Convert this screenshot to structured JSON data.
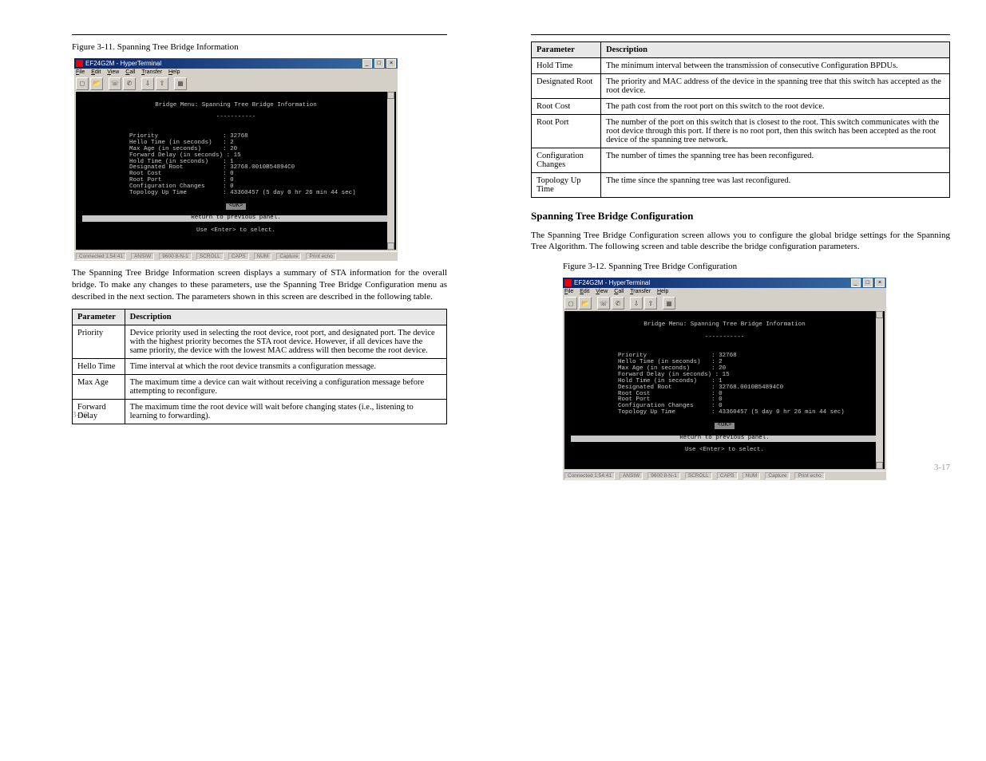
{
  "left": {
    "header": {
      "left": "",
      "right": ""
    },
    "figure_label": "Figure 3-11. Spanning Tree Bridge Information",
    "term": {
      "title": "EF24G2M - HyperTerminal",
      "menus": [
        "File",
        "Edit",
        "View",
        "Call",
        "Transfer",
        "Help"
      ],
      "screen_title": "Bridge Menu: Spanning Tree Bridge Information",
      "dashes": "-----------",
      "rows": [
        {
          "label": "Priority",
          "value": "32768"
        },
        {
          "label": "Hello Time (in seconds)",
          "value": "2"
        },
        {
          "label": "Max Age (in seconds)",
          "value": "20"
        },
        {
          "label": "Forward Delay (in seconds)",
          "value": "15"
        },
        {
          "label": "Hold Time (in seconds)",
          "value": "1"
        },
        {
          "label": "Designated Root",
          "value": "32768.0010B54894C0"
        },
        {
          "label": "Root Cost",
          "value": "0"
        },
        {
          "label": "Root Port",
          "value": "0"
        },
        {
          "label": "Configuration Changes",
          "value": "0"
        },
        {
          "label": "Topology Up Time",
          "value": "43360457 (5 day 0 hr 26 min 44 sec)"
        }
      ],
      "ok": "<OK>",
      "return_line": "Return to previous panel.",
      "enter_line": "Use <Enter> to select.",
      "status": [
        "Connected 1:54:41",
        "ANSIW",
        "9600 8-N-1",
        "SCROLL",
        "CAPS",
        "NUM",
        "Capture",
        "Print echo"
      ]
    },
    "para1": "The Spanning Tree Bridge Information screen displays a summary of STA information for the overall bridge. To make any changes to these parameters, use the Spanning Tree Bridge Configuration menu as described in the next section. The parameters shown in this screen are described in the following table.",
    "table": {
      "headers": [
        "Parameter",
        "Description"
      ],
      "rows": [
        [
          "Priority",
          "Device priority used in selecting the root device, root port, and designated port. The device with the highest priority becomes the STA root device. However, if all devices have the same priority, the device with the lowest MAC address will then become the root device."
        ],
        [
          "Hello Time",
          "Time interval at which the root device transmits a configuration message."
        ],
        [
          "Max Age",
          "The maximum time a device can wait without receiving a configuration message before attempting to reconfigure."
        ],
        [
          "Forward Delay",
          "The maximum time the root device will wait before changing states (i.e., listening to learning to forwarding)."
        ]
      ]
    },
    "page_no": "3-16"
  },
  "right": {
    "header": {
      "left": "",
      "right": ""
    },
    "table": {
      "headers": [
        "Parameter",
        "Description"
      ],
      "rows": [
        [
          "Hold Time",
          "The minimum interval between the transmission of consecutive Configuration BPDUs."
        ],
        [
          "Designated Root",
          "The priority and MAC address of the device in the spanning tree that this switch has accepted as the root device."
        ],
        [
          "Root Cost",
          "The path cost from the root port on this switch to the root device."
        ],
        [
          "Root Port",
          "The number of the port on this switch that is closest to the root. This switch communicates with the root device through this port. If there is no root port, then this switch has been accepted as the root device of the spanning tree network."
        ],
        [
          "Configuration Changes",
          "The number of times the spanning tree has been reconfigured."
        ],
        [
          "Topology Up Time",
          "The time since the spanning tree was last reconfigured."
        ]
      ]
    },
    "section_title": "Spanning Tree Bridge Configuration",
    "figure_label": "Figure 3-12. Spanning Tree Bridge Configuration",
    "para1": "The Spanning Tree Bridge Configuration screen allows you to configure the global bridge settings for the Spanning Tree Algorithm. The following screen and table describe the bridge configuration parameters.",
    "page_no": "3-17"
  }
}
